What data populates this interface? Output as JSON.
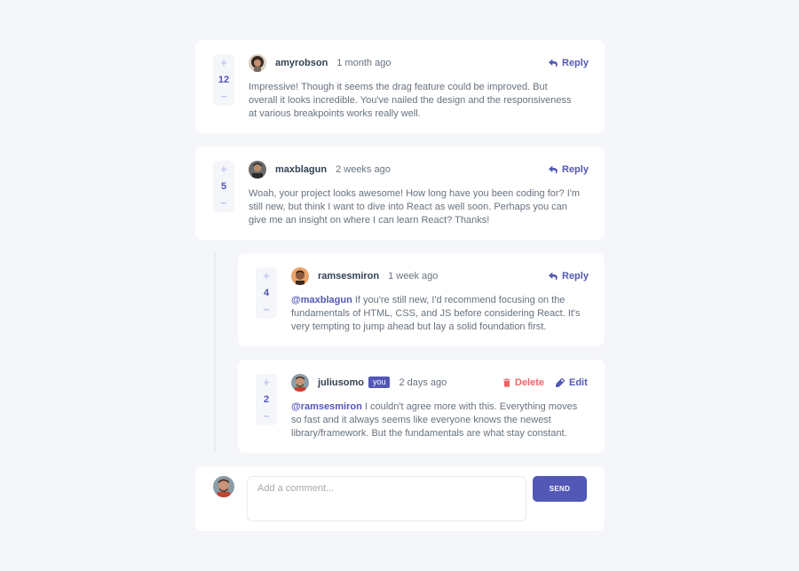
{
  "icons": {
    "plus": "+",
    "minus": "−",
    "reply": "reply-icon",
    "delete": "delete-icon",
    "edit": "edit-icon"
  },
  "colors": {
    "moderate_blue": "#5357b6",
    "light_grayish_blue": "#c5c6ef",
    "soft_red": "#ed6368",
    "dark_blue": "#324152",
    "grayish_blue": "#67727e",
    "background": "#f5f6fa"
  },
  "comments": [
    {
      "score": "12",
      "username": "amyrobson",
      "time": "1 month ago",
      "action": "Reply",
      "text": "Impressive! Though it seems the drag feature could be improved. But overall it looks incredible. You've nailed the design and the responsiveness at various breakpoints works really well."
    },
    {
      "score": "5",
      "username": "maxblagun",
      "time": "2 weeks ago",
      "action": "Reply",
      "text": "Woah, your project looks awesome! How long have you been coding for? I'm still new, but think I want to dive into React as well soon. Perhaps you can give me an insight on where I can learn React? Thanks!"
    }
  ],
  "replies": [
    {
      "score": "4",
      "username": "ramsesmiron",
      "time": "1 week ago",
      "action": "Reply",
      "mention": "@maxblagun",
      "text": " If you're still new, I'd recommend focusing on the fundamentals of HTML, CSS, and JS before considering React. It's very tempting to jump ahead but lay a solid foundation first."
    },
    {
      "score": "2",
      "username": "juliusomo",
      "badge": "you",
      "time": "2 days ago",
      "delete_label": "Delete",
      "edit_label": "Edit",
      "mention": "@ramsesmiron",
      "text": " I couldn't agree more with this. Everything moves so fast and it always seems like everyone knows the newest library/framework. But the fundamentals are what stay constant."
    }
  ],
  "add_comment": {
    "placeholder": "Add a comment...",
    "send_label": "SEND"
  }
}
